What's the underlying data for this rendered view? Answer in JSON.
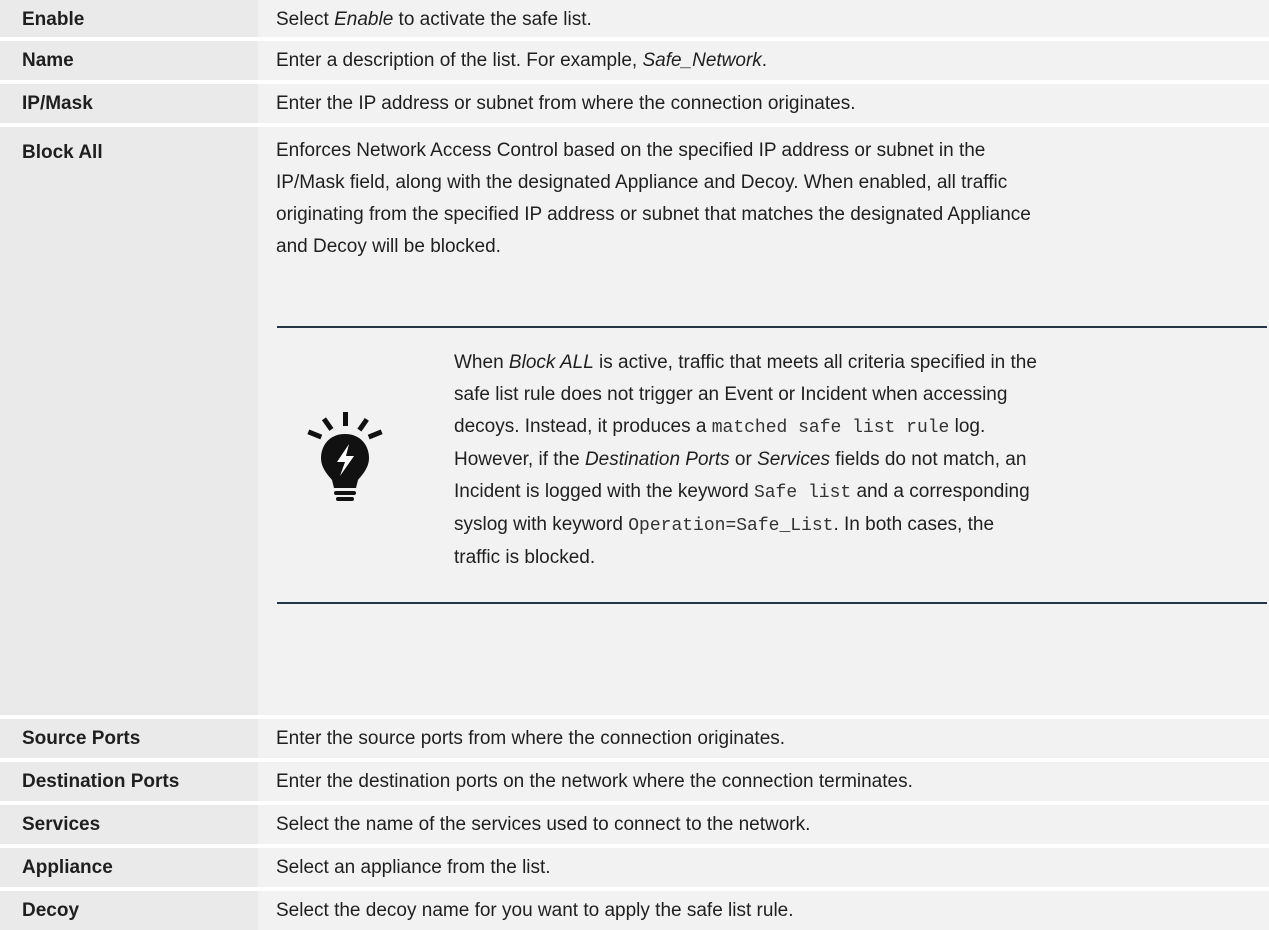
{
  "rows": [
    {
      "label": "Enable",
      "desc_pre": "Select ",
      "desc_em": "Enable",
      "desc_post": " to activate the safe list."
    },
    {
      "label": "Name",
      "desc_pre": "Enter a description of the list. For example, ",
      "desc_em": "Safe_Network",
      "desc_post": "."
    },
    {
      "label": "IP/Mask",
      "desc": "Enter the IP address or subnet from where the connection originates."
    },
    {
      "label": "Block All",
      "desc_lines": [
        "Enforces Network Access Control based on the specified IP address or subnet in the",
        "IP/Mask field, along with the designated Appliance and Decoy. When enabled, all traffic",
        "originating from the specified IP address or subnet that matches the designated Appliance",
        "and Decoy will be blocked."
      ]
    },
    {
      "label": "Source Ports",
      "desc": "Enter the source ports from where the connection originates."
    },
    {
      "label": "Destination Ports",
      "desc": "Enter the destination ports on the network where the connection terminates."
    },
    {
      "label": "Services",
      "desc": "Select the name of the services used to connect to the network."
    },
    {
      "label": "Appliance",
      "desc": "Select an appliance from the list."
    },
    {
      "label": "Decoy",
      "desc": "Select the decoy name for you want to apply the safe list rule."
    }
  ],
  "note": {
    "icon": "lightbulb-icon",
    "l1_pre": "When ",
    "l1_em": "Block ALL",
    "l1_post": " is active, traffic that meets all criteria specified in the",
    "l2": "safe list rule does not trigger an Event or Incident when accessing",
    "l3_pre": "decoys. Instead, it produces a ",
    "l3_code": "matched safe list rule",
    "l3_post": " log.",
    "l4_pre": "However, if the ",
    "l4_em1": "Destination Ports",
    "l4_mid": " or ",
    "l4_em2": "Services",
    "l4_post": " fields do not match, an",
    "l5_pre": "Incident is logged with the keyword ",
    "l5_code": "Safe list",
    "l5_post": " and a corresponding",
    "l6_pre": "syslog with keyword ",
    "l6_code": "Operation=Safe_List",
    "l6_post": ". In both cases, the",
    "l7": "traffic is blocked."
  }
}
